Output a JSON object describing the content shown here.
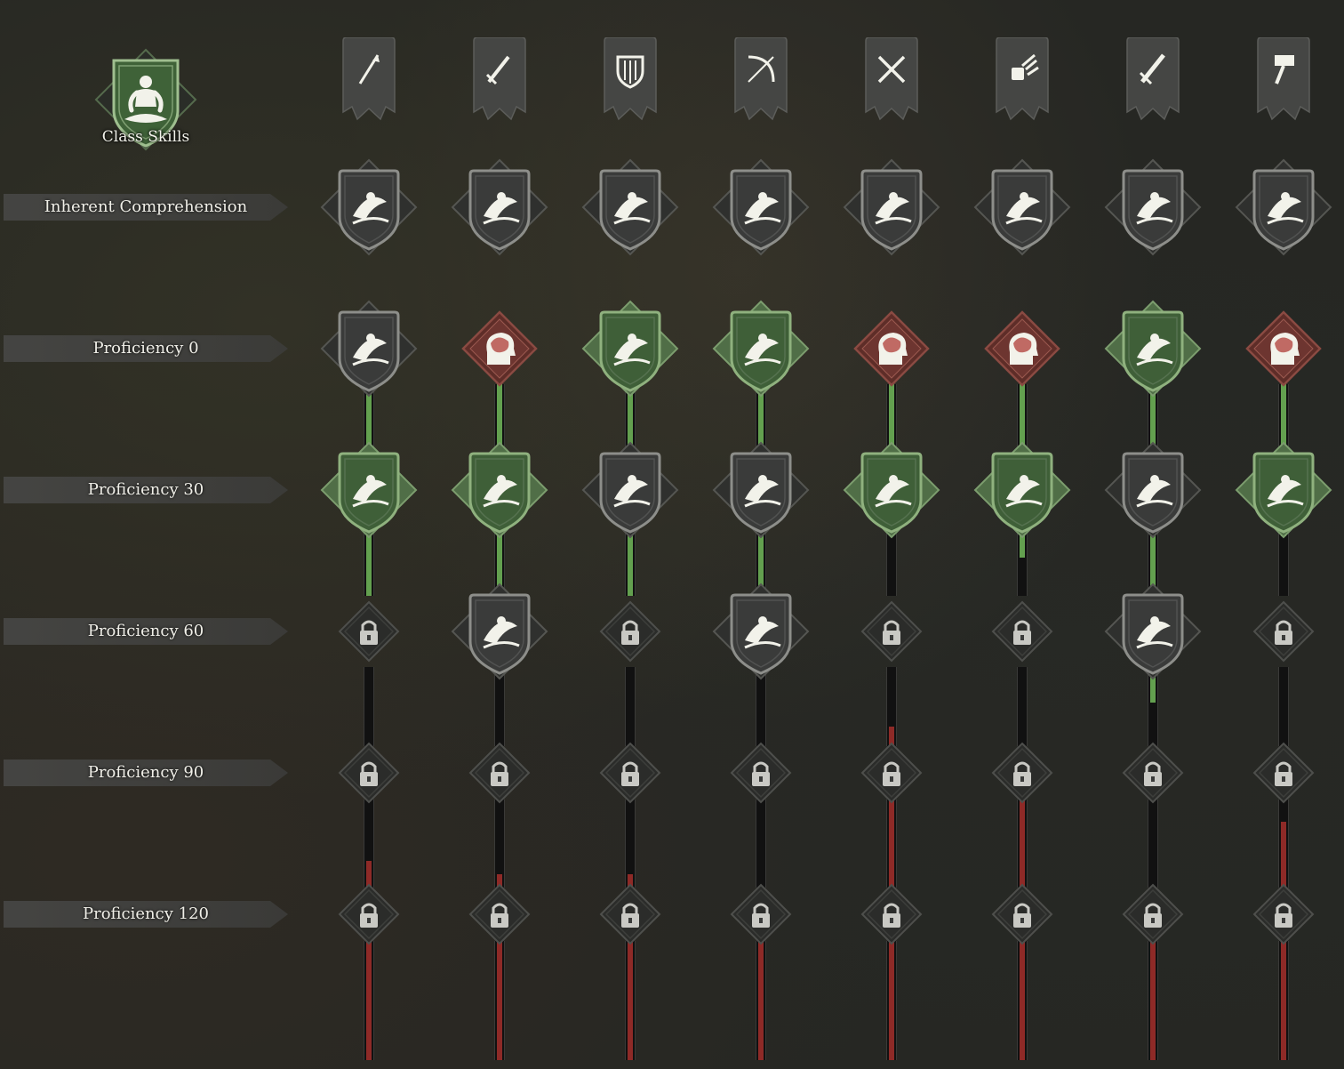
{
  "class_skills": {
    "label": "Class Skills",
    "icon": "meditation-icon"
  },
  "rows": [
    {
      "label": "Inherent Comprehension"
    },
    {
      "label": "Proficiency 0"
    },
    {
      "label": "Proficiency 30"
    },
    {
      "label": "Proficiency 60"
    },
    {
      "label": "Proficiency 90"
    },
    {
      "label": "Proficiency 120"
    }
  ],
  "colors": {
    "unlocked_green": "#63a04f",
    "progress_red": "#8e2a27",
    "locked_gray": "#3a3b3a",
    "brain_red": "#7a3a34"
  },
  "weapons": [
    {
      "name": "spear",
      "icon": "spear-icon",
      "skills": [
        "spear-whirl-icon",
        "spear-strike-icon",
        "spear-thrust-icon",
        "lock-icon",
        "lock-icon",
        "lock-icon"
      ],
      "states": [
        "gray",
        "gray",
        "green",
        "locked",
        "locked",
        "locked"
      ],
      "progress": {
        "p0_to_p30": 1.0,
        "p30_to_p60": 1.0,
        "p60_to_p90": 0.0,
        "p90_to_p120": 0.3,
        "p120_beyond": 1.0
      }
    },
    {
      "name": "sword",
      "icon": "sword-icon",
      "skills": [
        "slash-runner-icon",
        "brain-icon",
        "leaping-warrior-icon",
        "crescent-slash-icon",
        "lock-icon",
        "lock-icon"
      ],
      "states": [
        "gray",
        "red",
        "green",
        "gray",
        "locked",
        "locked"
      ],
      "progress": {
        "p0_to_p30": 1.0,
        "p30_to_p60": 1.0,
        "p60_to_p90": 0.0,
        "p90_to_p120": 0.15,
        "p120_beyond": 1.0
      }
    },
    {
      "name": "shield",
      "icon": "shield-icon",
      "skills": [
        "shield-bash-icon",
        "shield-guard-icon",
        "shield-spin-icon",
        "lock-icon",
        "lock-icon",
        "lock-icon"
      ],
      "states": [
        "gray",
        "green",
        "gray",
        "locked",
        "locked",
        "locked"
      ],
      "progress": {
        "p0_to_p30": 1.0,
        "p30_to_p60": 1.0,
        "p60_to_p90": 0.0,
        "p90_to_p120": 0.15,
        "p120_beyond": 1.0
      }
    },
    {
      "name": "bow",
      "icon": "bow-icon",
      "skills": [
        "archer-icon",
        "arrow-volley-icon",
        "swirl-arrow-icon",
        "target-arrows-icon",
        "lock-icon",
        "lock-icon"
      ],
      "states": [
        "gray",
        "green",
        "gray",
        "gray",
        "locked",
        "locked"
      ],
      "progress": {
        "p0_to_p30": 1.0,
        "p30_to_p60": 1.0,
        "p60_to_p90": 0.1,
        "p90_to_p120": 0.0,
        "p120_beyond": 1.0
      }
    },
    {
      "name": "dual-blades",
      "icon": "crossed-swords-icon",
      "skills": [
        "blade-flurry-icon",
        "brain-icon",
        "dash-strike-icon",
        "lock-icon",
        "lock-icon",
        "lock-icon"
      ],
      "states": [
        "gray",
        "red",
        "green",
        "locked",
        "locked",
        "locked"
      ],
      "progress": {
        "p0_to_p30": 1.0,
        "p30_to_p60": 0.08,
        "p60_to_p90": 0.25,
        "p90_to_p120": 1.0,
        "p120_beyond": 1.0
      }
    },
    {
      "name": "gauntlet",
      "icon": "claw-gauntlet-icon",
      "skills": [
        "flying-kick-icon",
        "brain-icon",
        "punch-icon",
        "lock-icon",
        "lock-icon",
        "lock-icon"
      ],
      "states": [
        "gray",
        "red",
        "green",
        "locked",
        "locked",
        "locked"
      ],
      "progress": {
        "p0_to_p30": 1.0,
        "p30_to_p60": 0.45,
        "p60_to_p90": 0.0,
        "p90_to_p120": 1.0,
        "p120_beyond": 1.0
      }
    },
    {
      "name": "greatsword",
      "icon": "greatsword-icon",
      "skills": [
        "sword-spin-icon",
        "lightning-slash-icon",
        "wind-slash-icon",
        "wave-slash-icon",
        "lock-icon",
        "lock-icon"
      ],
      "states": [
        "gray",
        "green",
        "gray",
        "gray",
        "locked",
        "locked"
      ],
      "progress": {
        "p0_to_p30": 1.0,
        "p30_to_p60": 1.0,
        "p60_to_p90": 0.45,
        "p90_to_p120": 0.0,
        "p120_beyond": 1.0
      }
    },
    {
      "name": "hammer",
      "icon": "hammer-icon",
      "skills": [
        "strongman-icon",
        "brain-icon",
        "hammer-smash-icon",
        "lock-icon",
        "lock-icon",
        "lock-icon"
      ],
      "states": [
        "gray",
        "red",
        "green",
        "locked",
        "locked",
        "locked"
      ],
      "progress": {
        "p0_to_p30": 1.0,
        "p30_to_p60": 0.15,
        "p60_to_p90": 0.0,
        "p90_to_p120": 0.75,
        "p120_beyond": 1.0
      }
    }
  ]
}
